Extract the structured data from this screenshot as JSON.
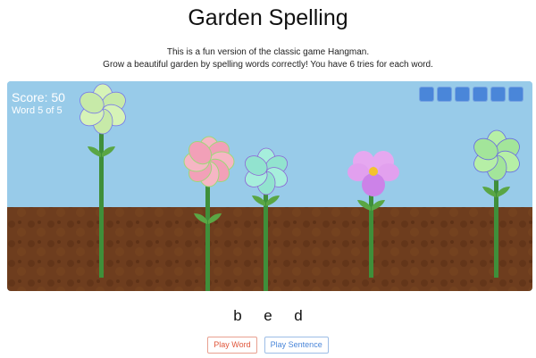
{
  "title": "Garden Spelling",
  "intro": {
    "line1": "This is a fun version of the classic game Hangman.",
    "line2": "Grow a beautiful garden by spelling words correctly! You have 6 tries for each word."
  },
  "hud": {
    "score": "Score: 50",
    "progress": "Word 5 of 5",
    "tries_remaining": 6
  },
  "word": {
    "letters": [
      "b",
      "e",
      "d"
    ]
  },
  "buttons": {
    "play_word": "Play Word",
    "play_sentence": "Play Sentence"
  },
  "colors": {
    "sky": "#98cbe9",
    "soil": "#6b3a1c",
    "stem": "#3f8f3a",
    "try_box": "#4a86d9"
  },
  "flowers": [
    {
      "name": "pinwheel-flower-lightgreen",
      "petal_colors": [
        "#d6f3b7",
        "#c7eaa8"
      ],
      "edge": "#7a7ae8"
    },
    {
      "name": "round-flower-pink",
      "petal_colors": [
        "#f6b6c4",
        "#f2a0b8"
      ],
      "edge": "#9fd77a"
    },
    {
      "name": "pinwheel-flower-teal",
      "petal_colors": [
        "#a6eedc",
        "#92e3cf"
      ],
      "edge": "#8c64d6"
    },
    {
      "name": "pansy-flower-violet",
      "petal_colors": [
        "#e6a8f0",
        "#cc82e8"
      ],
      "center": "#f4c22c"
    },
    {
      "name": "pinwheel-flower-green",
      "petal_colors": [
        "#b6efa6",
        "#a3e59a"
      ],
      "edge": "#6b6be0"
    }
  ]
}
